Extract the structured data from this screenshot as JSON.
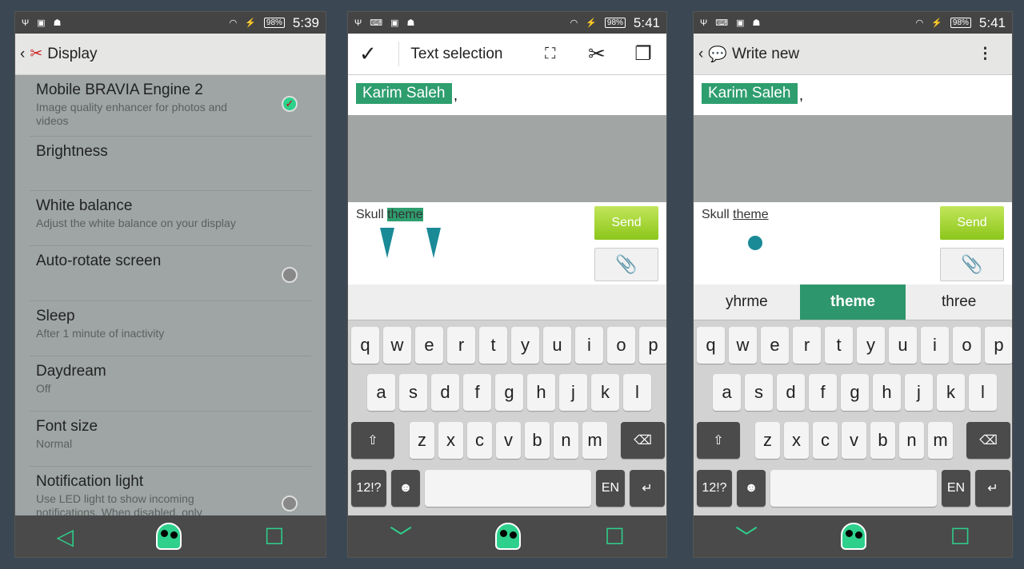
{
  "status": [
    {
      "time": "5:39",
      "battery": "98%"
    },
    {
      "time": "5:41",
      "battery": "98%"
    },
    {
      "time": "5:41",
      "battery": "98%"
    }
  ],
  "display": {
    "title": "Display",
    "items": [
      {
        "title": "Mobile BRAVIA Engine 2",
        "subtitle": "Image quality enhancer for photos and videos",
        "toggle": "on"
      },
      {
        "title": "Brightness",
        "subtitle": ""
      },
      {
        "title": "White balance",
        "subtitle": "Adjust the white balance on your display"
      },
      {
        "title": "Auto-rotate screen",
        "subtitle": "",
        "toggle": "off"
      },
      {
        "title": "Sleep",
        "subtitle": "After 1 minute of inactivity"
      },
      {
        "title": "Daydream",
        "subtitle": "Off"
      },
      {
        "title": "Font size",
        "subtitle": "Normal"
      },
      {
        "title": "Notification light",
        "subtitle": "Use LED light to show incoming notifications. When disabled, only",
        "toggle": "off"
      }
    ]
  },
  "selection": {
    "title": "Text selection"
  },
  "write": {
    "title": "Write new"
  },
  "message": {
    "recipient": "Karim Saleh",
    "comma": ",",
    "text_prefix": "Skull ",
    "text_word": "theme",
    "send": "Send"
  },
  "suggestions": [
    "yhrme",
    "theme",
    "three"
  ],
  "keyboard": {
    "row1": [
      "q",
      "w",
      "e",
      "r",
      "t",
      "y",
      "u",
      "i",
      "o",
      "p"
    ],
    "row2": [
      "a",
      "s",
      "d",
      "f",
      "g",
      "h",
      "j",
      "k",
      "l"
    ],
    "row3": [
      "z",
      "x",
      "c",
      "v",
      "b",
      "n",
      "m"
    ],
    "sym": "12!?",
    "lang": "EN"
  },
  "colors": {
    "accent": "#2ed08c",
    "chip": "#2e9e6e",
    "send": "#8cc61a",
    "handle": "#1a8a96"
  }
}
